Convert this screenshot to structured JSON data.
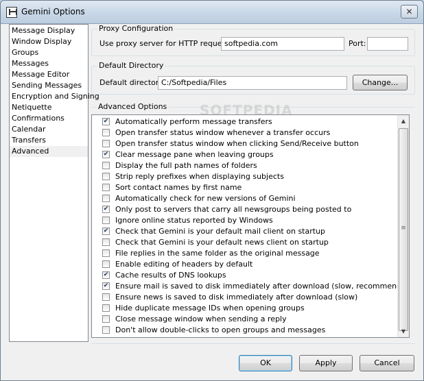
{
  "window": {
    "title": "Gemini Options",
    "close_glyph": "✕"
  },
  "nav": {
    "items": [
      {
        "label": "Message Display"
      },
      {
        "label": "Window Display"
      },
      {
        "label": "Groups"
      },
      {
        "label": "Messages"
      },
      {
        "label": "Message Editor"
      },
      {
        "label": "Sending Messages"
      },
      {
        "label": "Encryption and Signing"
      },
      {
        "label": "Netiquette"
      },
      {
        "label": "Confirmations"
      },
      {
        "label": "Calendar"
      },
      {
        "label": "Transfers"
      },
      {
        "label": "Advanced"
      }
    ],
    "selected": "Advanced"
  },
  "proxy": {
    "group_label": "Proxy Configuration",
    "server_label": "Use proxy server for HTTP requests:",
    "server_value": "softpedia.com",
    "port_label": "Port:",
    "port_value": ""
  },
  "directory": {
    "group_label": "Default Directory",
    "label": "Default directory:",
    "value": "C:/Softpedia/Files",
    "change_button": "Change..."
  },
  "advanced": {
    "group_label": "Advanced Options",
    "options": [
      {
        "label": "Automatically perform message transfers",
        "checked": true
      },
      {
        "label": "Open transfer status window whenever a transfer occurs",
        "checked": false
      },
      {
        "label": "Open transfer status window when clicking Send/Receive button",
        "checked": false
      },
      {
        "label": "Clear message pane when leaving groups",
        "checked": true
      },
      {
        "label": "Display the full path names of folders",
        "checked": false
      },
      {
        "label": "Strip reply prefixes when displaying subjects",
        "checked": false
      },
      {
        "label": "Sort contact names by first name",
        "checked": false
      },
      {
        "label": "Automatically check for new versions of Gemini",
        "checked": false
      },
      {
        "label": "Only post to servers that carry all newsgroups being posted to",
        "checked": true
      },
      {
        "label": "Ignore online status reported by Windows",
        "checked": false
      },
      {
        "label": "Check that Gemini is your default mail client on startup",
        "checked": true
      },
      {
        "label": "Check that Gemini is your default news client on startup",
        "checked": false
      },
      {
        "label": "File replies in the same folder as the original message",
        "checked": false
      },
      {
        "label": "Enable editing of headers by default",
        "checked": false
      },
      {
        "label": "Cache results of DNS lookups",
        "checked": true
      },
      {
        "label": "Ensure mail is saved to disk immediately after download (slow, recommended)",
        "checked": true
      },
      {
        "label": "Ensure news is saved to disk immediately after download (slow)",
        "checked": false
      },
      {
        "label": "Hide duplicate message IDs when opening groups",
        "checked": false
      },
      {
        "label": "Close message window when sending a reply",
        "checked": false
      },
      {
        "label": "Don't allow double-clicks to open groups and messages",
        "checked": false
      }
    ],
    "check_glyph": "✔"
  },
  "scrollbar": {
    "up_glyph": "▲",
    "down_glyph": "▼",
    "grip_glyph": "≡"
  },
  "watermark": "SOFTPEDIA",
  "footer": {
    "ok": "OK",
    "apply": "Apply",
    "cancel": "Cancel"
  }
}
